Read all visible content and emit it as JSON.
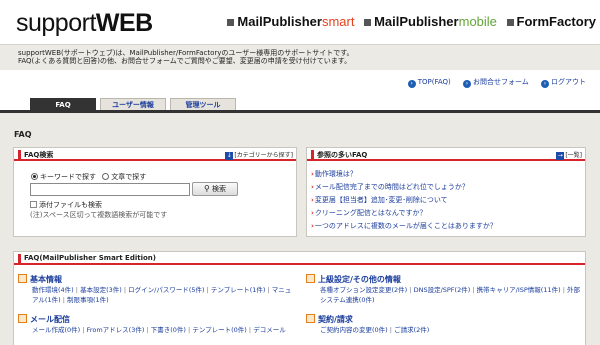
{
  "header": {
    "logo_support": "support",
    "logo_web": "WEB",
    "products": [
      {
        "name": "MailPublisher",
        "suffix": "smart",
        "suffix_color": "#e8401c"
      },
      {
        "name": "MailPublisher",
        "suffix": "mobile",
        "suffix_color": "#63a53a"
      },
      {
        "name": "FormFactory",
        "suffix": ""
      }
    ]
  },
  "intro": {
    "line1": "supportWEB(サポートウェブ)は、MailPublisher/FormFactoryのユーザー様専用のサポートサイトです。",
    "line2": "FAQ(よくある質問と回答)の他、お問合せフォームでご質問やご要望、変更届の申請を受け付けています。"
  },
  "toplinks": [
    {
      "icon": "arrow-right-icon",
      "label": "TOP(FAQ)"
    },
    {
      "icon": "arrow-right-icon",
      "label": "お問合せフォーム"
    },
    {
      "icon": "arrow-right-icon",
      "label": "ログアウト"
    }
  ],
  "tabs": [
    {
      "label": "FAQ",
      "active": true
    },
    {
      "label": "ユーザー情報",
      "active": false
    },
    {
      "label": "管理ツール",
      "active": false
    }
  ],
  "section_title": "FAQ",
  "search_panel": {
    "title": "FAQ検索",
    "more_label": "[カテゴリーから探す]",
    "radio_keyword": "キーワードで探す",
    "radio_sentence": "文章で探す",
    "search_value": "",
    "search_button": "検索",
    "attach_label": "添付ファイルも検索",
    "note": "(注)スペース区切って複数語検索が可能です"
  },
  "ref_panel": {
    "title": "参照の多いFAQ",
    "more_label": "[一覧]",
    "items": [
      "動作環境は？",
      "メール配信完了までの時間はどれ位でしょうか？",
      "変更届【担当者】追加･変更･削除について",
      "クリーニング配信とはなんですか？",
      "一つのアドレスに複数のメールが届くことはありますか？"
    ]
  },
  "faq_panel": {
    "title": "FAQ(MailPublisher Smart Edition)",
    "categories": [
      {
        "title": "基本情報",
        "links": [
          "動作環境(4件)",
          "基本設定(3件)",
          "ログイン/パスワード(5件)",
          "テンプレート(1件)",
          "マニュアル(1件)",
          "制限事項(1件)"
        ]
      },
      {
        "title": "上級設定/その他の情報",
        "links": [
          "各種オプション設定変更(2件)",
          "DNS設定/SPF(2件)",
          "携帯キャリア/ISP情報(11件)",
          "外部システム連携(0件)"
        ]
      },
      {
        "title": "メール配信",
        "links": [
          "メール作成(0件)",
          "Fromアドレス(3件)",
          "下書き(0件)",
          "テンプレート(0件)",
          "デコメール"
        ]
      },
      {
        "title": "契約/請求",
        "links": [
          "ご契約内容の変更(0件)",
          "ご請求(2件)"
        ]
      }
    ]
  }
}
